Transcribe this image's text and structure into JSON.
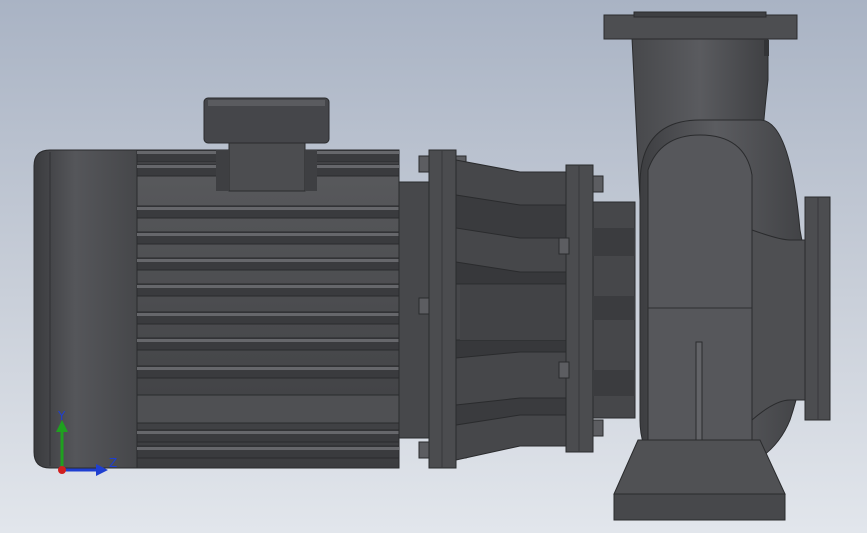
{
  "viewport": {
    "background_top": "#a9b3c4",
    "background_bottom": "#e2e6ec"
  },
  "model": {
    "description_icon": "centrifugal-pump-icon",
    "body_color": "#4a4b4e",
    "dark_color": "#2e2f31",
    "light_color": "#6a6b6e"
  },
  "triad": {
    "y_label": "Y",
    "z_label": "Z",
    "y_color": "#1fa01f",
    "z_color": "#1f3fd0",
    "x_color": "#d01f1f"
  }
}
